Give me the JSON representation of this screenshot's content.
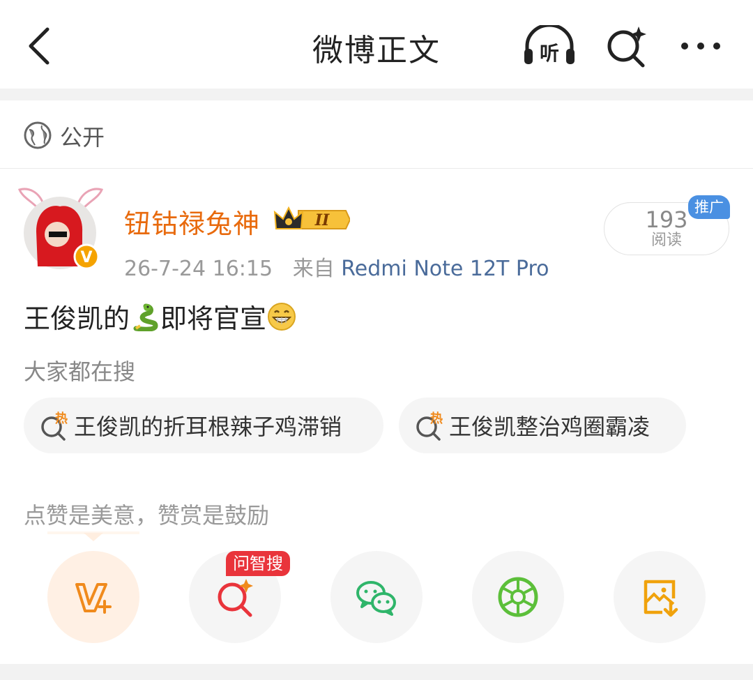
{
  "nav": {
    "title": "微博正文",
    "listen_glyph": "听"
  },
  "visibility": {
    "label": "公开"
  },
  "author": {
    "name": "钮钴禄兔神",
    "rank_badge": "II",
    "verified_badge": "V",
    "timestamp": "26-7-24 16:15",
    "source_prefix": "来自",
    "source": "Redmi Note 12T Pro"
  },
  "read_card": {
    "count": "193",
    "label": "阅读",
    "promo_tag": "推广"
  },
  "post": {
    "text_part1": "王俊凯的",
    "text_part2": "即将官宣",
    "emoji_1": "snake-emoji",
    "emoji_2": "grin-emoji"
  },
  "hot_search": {
    "title": "大家都在搜",
    "hot_glyph": "热",
    "items": [
      {
        "label": "王俊凯的折耳根辣子鸡滞销"
      },
      {
        "label": "王俊凯整治鸡圈霸凌"
      }
    ]
  },
  "reward": {
    "hint": "点赞是美意，赞赏是鼓励"
  },
  "share": {
    "ai_tag": "问智搜",
    "buttons": [
      {
        "icon": "v-plus-icon",
        "color": "#f08a1c"
      },
      {
        "icon": "ai-search-icon",
        "color": "#e9343b"
      },
      {
        "icon": "wechat-icon",
        "color": "#2fb56a"
      },
      {
        "icon": "moments-icon",
        "color": "#5cbf3a"
      },
      {
        "icon": "save-image-icon",
        "color": "#f0a20c"
      }
    ]
  },
  "colors": {
    "accent": "#e86a0d",
    "link": "#4a6b9a",
    "promo": "#4a90e2",
    "ai_red": "#e9343b"
  }
}
